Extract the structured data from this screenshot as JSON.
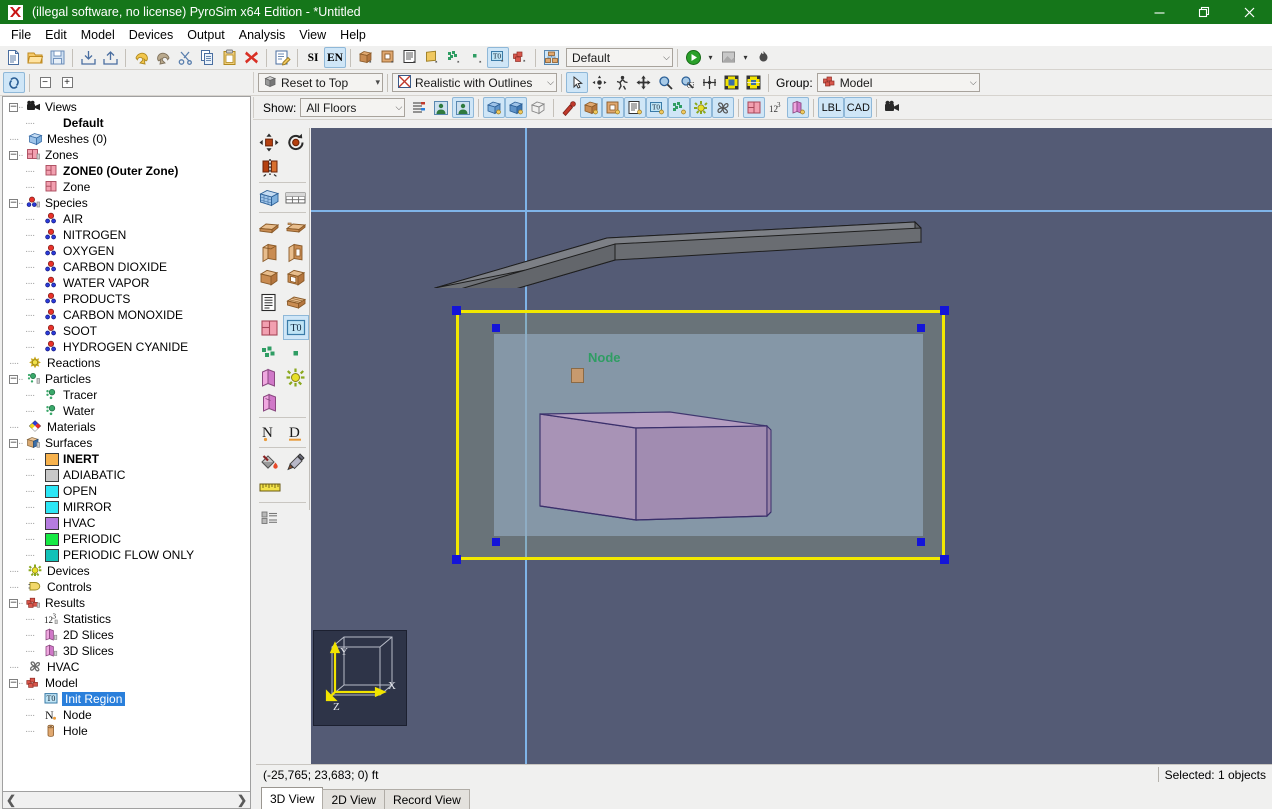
{
  "window": {
    "title": "(illegal software, no license) PyroSim x64 Edition - *Untitled",
    "app_icon": "pyrosim-logo-icon",
    "minimize": "—",
    "maximize": "❐",
    "close": "✕",
    "titlebar_color": "#15761a"
  },
  "menubar": {
    "items": [
      {
        "label": "File"
      },
      {
        "label": "Edit"
      },
      {
        "label": "Model"
      },
      {
        "label": "Devices"
      },
      {
        "label": "Output"
      },
      {
        "label": "Analysis"
      },
      {
        "label": "View"
      },
      {
        "label": "Help"
      }
    ]
  },
  "main_toolbar": {
    "buttons": [
      {
        "name": "new-file-icon",
        "tip": "New"
      },
      {
        "name": "open-folder-icon",
        "tip": "Open"
      },
      {
        "name": "save-icon",
        "tip": "Save"
      },
      {
        "name": "import-icon",
        "tip": "Import"
      },
      {
        "name": "export-icon",
        "tip": "Export"
      },
      {
        "name": "undo-icon",
        "tip": "Undo"
      },
      {
        "name": "redo-icon",
        "tip": "Redo"
      },
      {
        "name": "cut-scissors-icon",
        "tip": "Cut"
      },
      {
        "name": "copy-icon",
        "tip": "Copy"
      },
      {
        "name": "paste-clipboard-icon",
        "tip": "Paste"
      },
      {
        "name": "delete-x-icon",
        "tip": "Delete"
      },
      {
        "name": "edit-note-icon",
        "tip": "Edit"
      }
    ],
    "units": {
      "si_label": "SI",
      "en_label": "EN",
      "active": "EN"
    },
    "object_buttons": [
      {
        "name": "new-obstruction-icon"
      },
      {
        "name": "new-hole-icon"
      },
      {
        "name": "new-record-icon"
      },
      {
        "name": "new-vent-icon"
      },
      {
        "name": "new-particle-icon"
      },
      {
        "name": "new-small-particle-icon"
      },
      {
        "name": "new-init-region-icon",
        "active": true
      },
      {
        "name": "new-group-icon"
      }
    ],
    "group_icon": "organize-groups-icon",
    "view_select": {
      "value": "Default",
      "caret": "⌵"
    },
    "run_button": {
      "name": "run-fds-icon"
    },
    "run_caret": "▾",
    "results_button": {
      "name": "open-results-icon"
    },
    "results_caret": "▾",
    "smoke_button": {
      "name": "smokeview-icon"
    }
  },
  "view_toolbar": {
    "reset_combo": {
      "value": "Reset to Top",
      "icon": "cube-view-icon",
      "caret": "▾"
    },
    "render_combo": {
      "value": "Realistic with Outlines",
      "icon": "render-mode-icon",
      "caret": "⌵"
    },
    "nav_buttons": [
      {
        "name": "select-arrow-icon",
        "active": true
      },
      {
        "name": "orbit-icon"
      },
      {
        "name": "walk-icon"
      },
      {
        "name": "pan-icon"
      },
      {
        "name": "zoom-icon"
      },
      {
        "name": "zoom-region-icon"
      },
      {
        "name": "zoom-to-fit-icon"
      },
      {
        "name": "view-all-icon"
      },
      {
        "name": "view-selected-icon"
      }
    ],
    "group_label": "Group:",
    "group_combo": {
      "value": "Model",
      "icon": "model-group-icon",
      "caret": "⌵"
    }
  },
  "show_toolbar": {
    "show_label": "Show:",
    "floors_combo": {
      "value": "All Floors",
      "caret": "⌵"
    },
    "buttons": [
      {
        "name": "floor-list-icon"
      },
      {
        "name": "show-person-icon"
      },
      {
        "name": "show-person-alt-icon",
        "active": true
      },
      {
        "name": "show-mesh-icon",
        "active": true
      },
      {
        "name": "show-mesh-solid-icon",
        "active": true
      },
      {
        "name": "show-mesh-wire-icon"
      },
      {
        "name": "show-flow-icon"
      },
      {
        "name": "show-obstruction-icon",
        "active": true
      },
      {
        "name": "show-hole-icon",
        "active": true
      },
      {
        "name": "show-record-icon",
        "active": true
      },
      {
        "name": "show-init-region-icon",
        "active": true
      },
      {
        "name": "show-particle-icon",
        "active": true
      },
      {
        "name": "show-device-icon",
        "active": true
      },
      {
        "name": "show-hvac-icon",
        "active": true
      },
      {
        "name": "show-zone-icon",
        "active": true
      },
      {
        "name": "show-statistics-icon"
      },
      {
        "name": "show-slice-icon",
        "active": true
      }
    ],
    "lbl_button": {
      "label": "LBL",
      "active": true
    },
    "cad_button": {
      "label": "CAD",
      "active": true
    },
    "camera_button": {
      "name": "camera-icon"
    }
  },
  "left_toolbar": {
    "link_button": {
      "name": "link-views-icon",
      "active": true
    },
    "collapse_all": {
      "name": "collapse-all-icon",
      "glyph": "−"
    },
    "expand_all": {
      "name": "expand-all-icon",
      "glyph": "+"
    }
  },
  "tree": {
    "items": [
      {
        "label": "Views",
        "depth": 0,
        "icon": "camera-icon",
        "twist": "minus"
      },
      {
        "label": "Default",
        "depth": 1,
        "icon": "none",
        "bold": true
      },
      {
        "label": "Meshes (0)",
        "depth": 0,
        "icon": "mesh-icon"
      },
      {
        "label": "Zones",
        "depth": 0,
        "icon": "zone-icon",
        "twist": "minus"
      },
      {
        "label": "ZONE0 (Outer Zone)",
        "depth": 1,
        "icon": "zone-item-icon",
        "bold": true
      },
      {
        "label": "Zone",
        "depth": 1,
        "icon": "zone-item-icon"
      },
      {
        "label": "Species",
        "depth": 0,
        "icon": "species-icon",
        "twist": "minus"
      },
      {
        "label": "AIR",
        "depth": 1,
        "icon": "species-item-icon"
      },
      {
        "label": "NITROGEN",
        "depth": 1,
        "icon": "species-item-icon"
      },
      {
        "label": "OXYGEN",
        "depth": 1,
        "icon": "species-item-icon"
      },
      {
        "label": "CARBON DIOXIDE",
        "depth": 1,
        "icon": "species-item-icon"
      },
      {
        "label": "WATER VAPOR",
        "depth": 1,
        "icon": "species-item-icon"
      },
      {
        "label": "PRODUCTS",
        "depth": 1,
        "icon": "species-item-icon"
      },
      {
        "label": "CARBON MONOXIDE",
        "depth": 1,
        "icon": "species-item-icon"
      },
      {
        "label": "SOOT",
        "depth": 1,
        "icon": "species-item-icon"
      },
      {
        "label": "HYDROGEN CYANIDE",
        "depth": 1,
        "icon": "species-item-icon"
      },
      {
        "label": "Reactions",
        "depth": 0,
        "icon": "reaction-icon"
      },
      {
        "label": "Particles",
        "depth": 0,
        "icon": "particles-icon",
        "twist": "minus"
      },
      {
        "label": "Tracer",
        "depth": 1,
        "icon": "particle-item-icon"
      },
      {
        "label": "Water",
        "depth": 1,
        "icon": "particle-item-icon"
      },
      {
        "label": "Materials",
        "depth": 0,
        "icon": "materials-icon"
      },
      {
        "label": "Surfaces",
        "depth": 0,
        "icon": "surfaces-icon",
        "twist": "minus"
      },
      {
        "label": "INERT",
        "depth": 1,
        "icon": "swatch",
        "color": "#f7b24d",
        "bold": true
      },
      {
        "label": "ADIABATIC",
        "depth": 1,
        "icon": "swatch",
        "color": "#c8c8c8"
      },
      {
        "label": "OPEN",
        "depth": 1,
        "icon": "swatch",
        "color": "#2ce6f5"
      },
      {
        "label": "MIRROR",
        "depth": 1,
        "icon": "swatch",
        "color": "#2ce6f5"
      },
      {
        "label": "HVAC",
        "depth": 1,
        "icon": "swatch",
        "color": "#b57ce0"
      },
      {
        "label": "PERIODIC",
        "depth": 1,
        "icon": "swatch",
        "color": "#16ea44"
      },
      {
        "label": "PERIODIC FLOW ONLY",
        "depth": 1,
        "icon": "swatch",
        "color": "#12c2b8"
      },
      {
        "label": "Devices",
        "depth": 0,
        "icon": "devices-icon"
      },
      {
        "label": "Controls",
        "depth": 0,
        "icon": "controls-icon"
      },
      {
        "label": "Results",
        "depth": 0,
        "icon": "results-icon",
        "twist": "minus"
      },
      {
        "label": "Statistics",
        "depth": 1,
        "icon": "statistics-icon"
      },
      {
        "label": "2D Slices",
        "depth": 1,
        "icon": "slice2d-icon"
      },
      {
        "label": "3D Slices",
        "depth": 1,
        "icon": "slice3d-icon"
      },
      {
        "label": "HVAC",
        "depth": 0,
        "icon": "hvac-fan-icon"
      },
      {
        "label": "Model",
        "depth": 0,
        "icon": "model-icon",
        "twist": "minus"
      },
      {
        "label": "Init Region",
        "depth": 1,
        "icon": "init-region-icon",
        "selected": true
      },
      {
        "label": "Node",
        "depth": 1,
        "icon": "node-icon"
      },
      {
        "label": "Hole",
        "depth": 1,
        "icon": "hole-icon"
      }
    ]
  },
  "tool_palette": {
    "rows": [
      [
        {
          "name": "move-object-icon"
        },
        {
          "name": "rotate-object-icon"
        }
      ],
      [
        {
          "name": "mirror-object-icon"
        }
      ],
      [
        {
          "name": "new-mesh-icon"
        },
        {
          "name": "mesh-grid-icon"
        }
      ],
      [
        {
          "name": "draw-floor-icon"
        },
        {
          "name": "draw-slab-icon"
        }
      ],
      [
        {
          "name": "draw-wall-icon"
        },
        {
          "name": "draw-wall-opening-icon"
        }
      ],
      [
        {
          "name": "draw-box-icon"
        },
        {
          "name": "draw-hollow-box-icon"
        }
      ],
      [
        {
          "name": "draw-record-icon"
        },
        {
          "name": "draw-vent-icon"
        }
      ],
      [
        {
          "name": "draw-zone-icon"
        },
        {
          "name": "draw-init-region-icon",
          "active": true
        }
      ],
      [
        {
          "name": "draw-particles-icon"
        },
        {
          "name": "draw-particle-icon"
        }
      ],
      [
        {
          "name": "draw-slice2d-icon"
        },
        {
          "name": "draw-device-icon"
        }
      ],
      [
        {
          "name": "draw-slice3d-icon"
        }
      ],
      [
        {
          "name": "node-tool-icon"
        },
        {
          "name": "duct-tool-icon"
        }
      ],
      [
        {
          "name": "paint-bucket-icon"
        },
        {
          "name": "eyedropper-icon"
        }
      ],
      [
        {
          "name": "measure-ruler-icon"
        }
      ],
      [
        {
          "name": "properties-list-icon"
        }
      ]
    ]
  },
  "viewport": {
    "background_color": "#545b75",
    "crosshair_color": "#7fb4e8",
    "node_label": "Node",
    "node_label_color": "#2f9d63",
    "selection_color": "#f2e800",
    "handle_color": "#1414d8",
    "mesh_fill": "#8fa2b8",
    "obstruction_fill": "#ab93b8",
    "ceiling_beam_color": "#6f7277",
    "axis_widget": {
      "x_label": "X",
      "y_label": "Y",
      "z_label": "Z",
      "axis_color": "#f2e400"
    }
  },
  "statusbar": {
    "coordinates": "(-25,765; 23,683; 0) ft",
    "selection": "Selected: 1 objects"
  },
  "bottom_tabs": {
    "tabs": [
      {
        "label": "3D View",
        "active": true
      },
      {
        "label": "2D View",
        "active": false
      },
      {
        "label": "Record View",
        "active": false
      }
    ]
  }
}
